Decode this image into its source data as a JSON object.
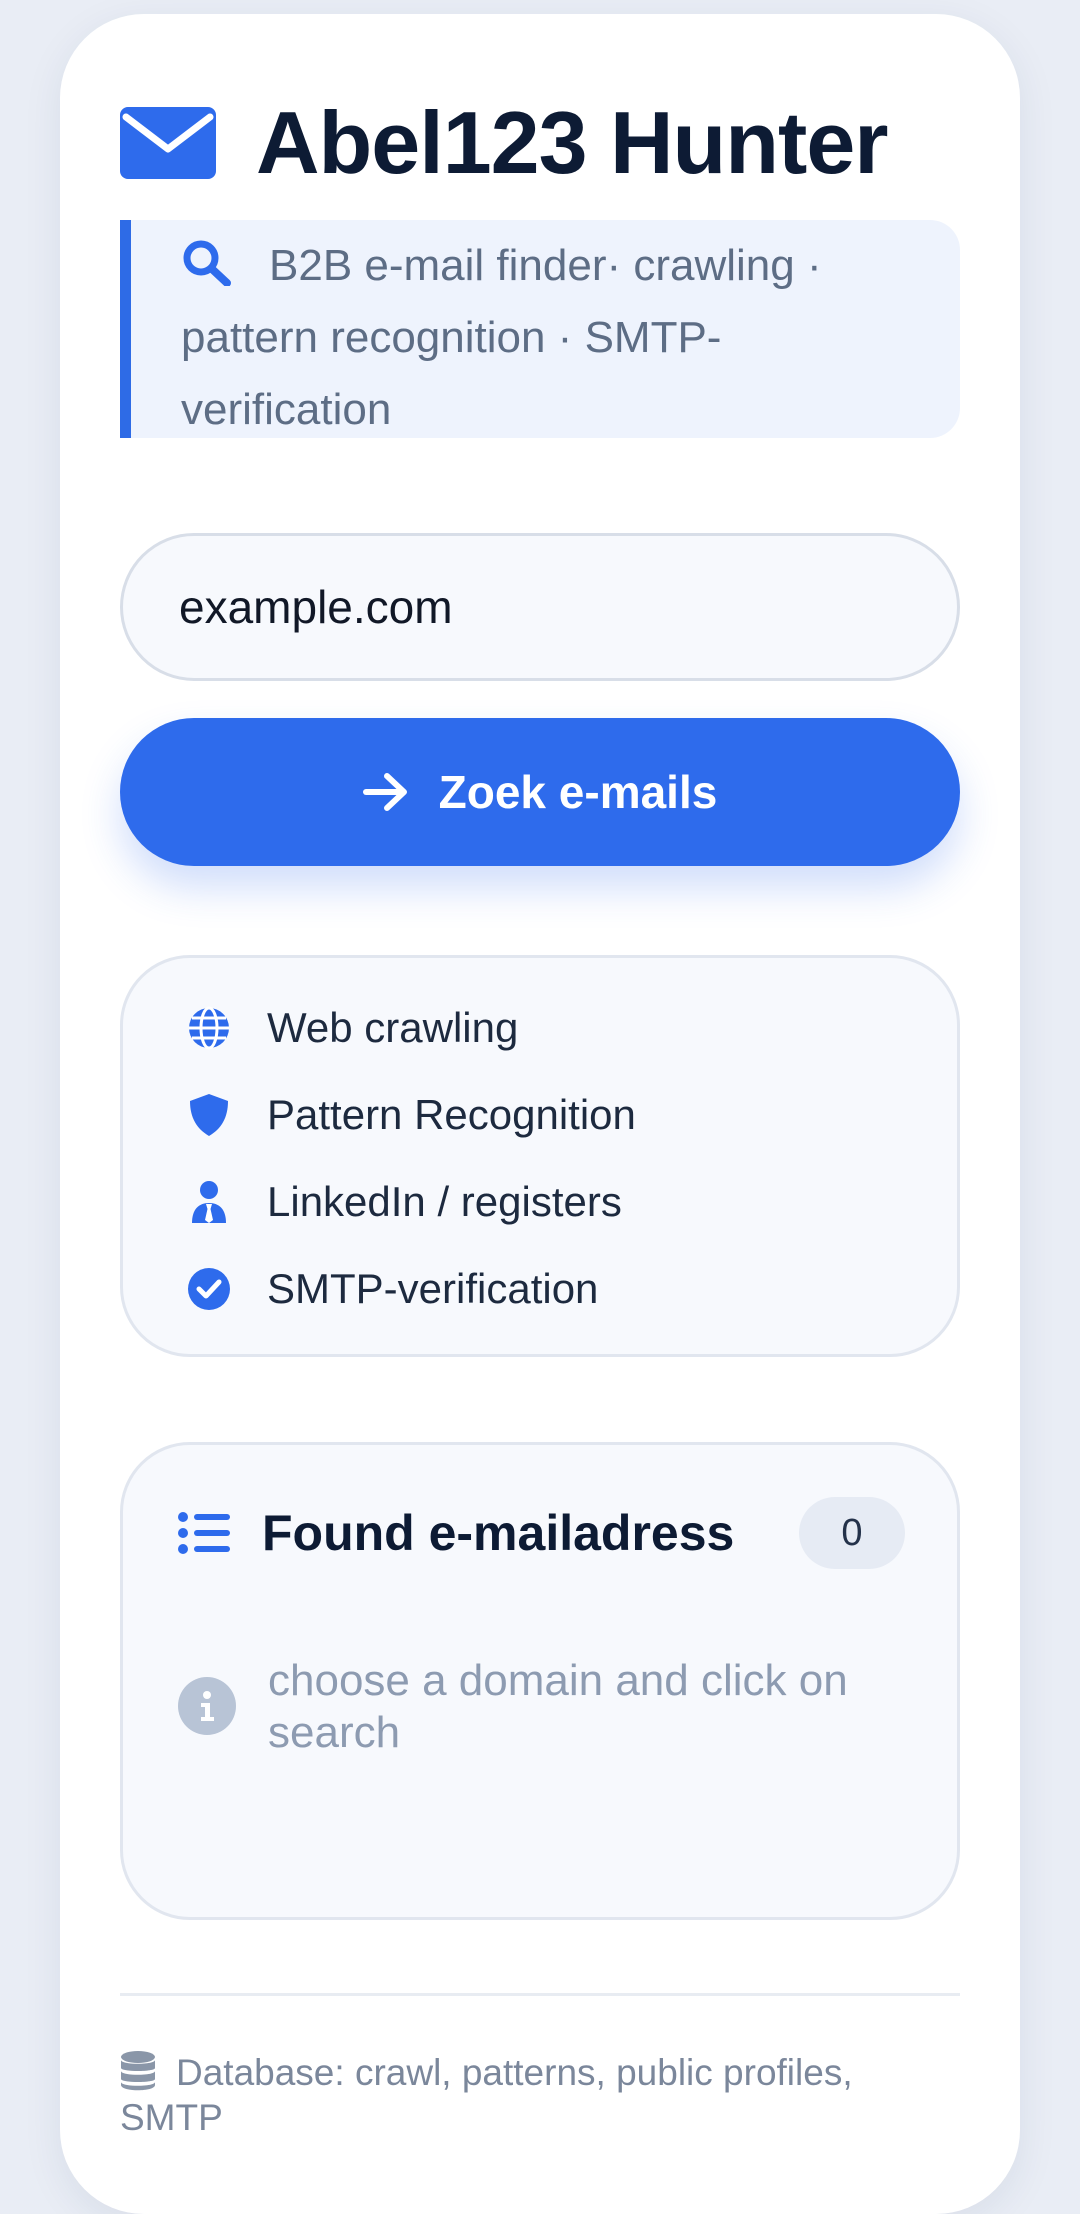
{
  "app": {
    "title": "Abel123 Hunter",
    "subtitle": "B2B e-mail finder· crawling · pattern recognition · SMTP-verification",
    "brand_icon": "envelope-icon",
    "subtitle_icon": "search-icon"
  },
  "search": {
    "domain_value": "example.com",
    "button_label": "Zoek e-mails",
    "button_icon": "arrow-right-icon"
  },
  "features": [
    {
      "icon": "globe-icon",
      "label": "Web crawling"
    },
    {
      "icon": "shield-icon",
      "label": "Pattern Recognition"
    },
    {
      "icon": "user-tie-icon",
      "label": "LinkedIn / registers"
    },
    {
      "icon": "check-circle-icon",
      "label": "SMTP-verification"
    }
  ],
  "results": {
    "title": "Found e-mailadress",
    "count": "0",
    "empty_message": "choose a domain and click on search",
    "title_icon": "list-icon",
    "empty_icon": "info-icon"
  },
  "footer": {
    "text": "Database: crawl, patterns, public profiles, SMTP",
    "icon": "database-icon"
  },
  "colors": {
    "accent": "#2e6bec",
    "title": "#0d1b34",
    "muted": "#8d9bb1",
    "page_bg": "#e9edf5",
    "panel_bg": "#f7f9fd"
  }
}
